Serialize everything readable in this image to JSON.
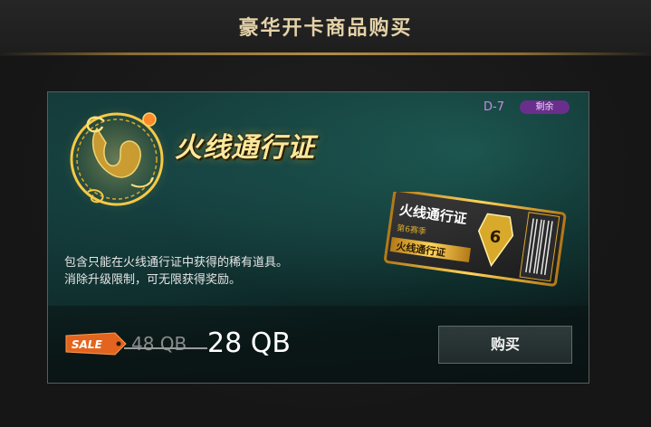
{
  "header": {
    "title": "豪华开卡商品购买"
  },
  "card": {
    "product_title": "火线通行证",
    "season_code": "D-7",
    "remaining_badge": "剩余",
    "description_line1": "包含只能在火线通行证中获得的稀有道具。",
    "description_line2": "消除升级限制，可无限获得奖励。",
    "ticket": {
      "title": "火线通行证",
      "subtitle": "第6赛季",
      "footer": "火线通行证"
    },
    "sale_label": "SALE",
    "original_price": "48 QB",
    "sale_price": "28 QB",
    "buy_label": "购买"
  },
  "colors": {
    "accent_gold": "#e4d2a8",
    "badge_purple": "#6a2f8c",
    "sale_orange": "#e2641f"
  },
  "icons": {
    "emblem": "golden-dragon-emblem",
    "ticket": "pass-ticket-image",
    "sale": "sale-tag-icon"
  }
}
